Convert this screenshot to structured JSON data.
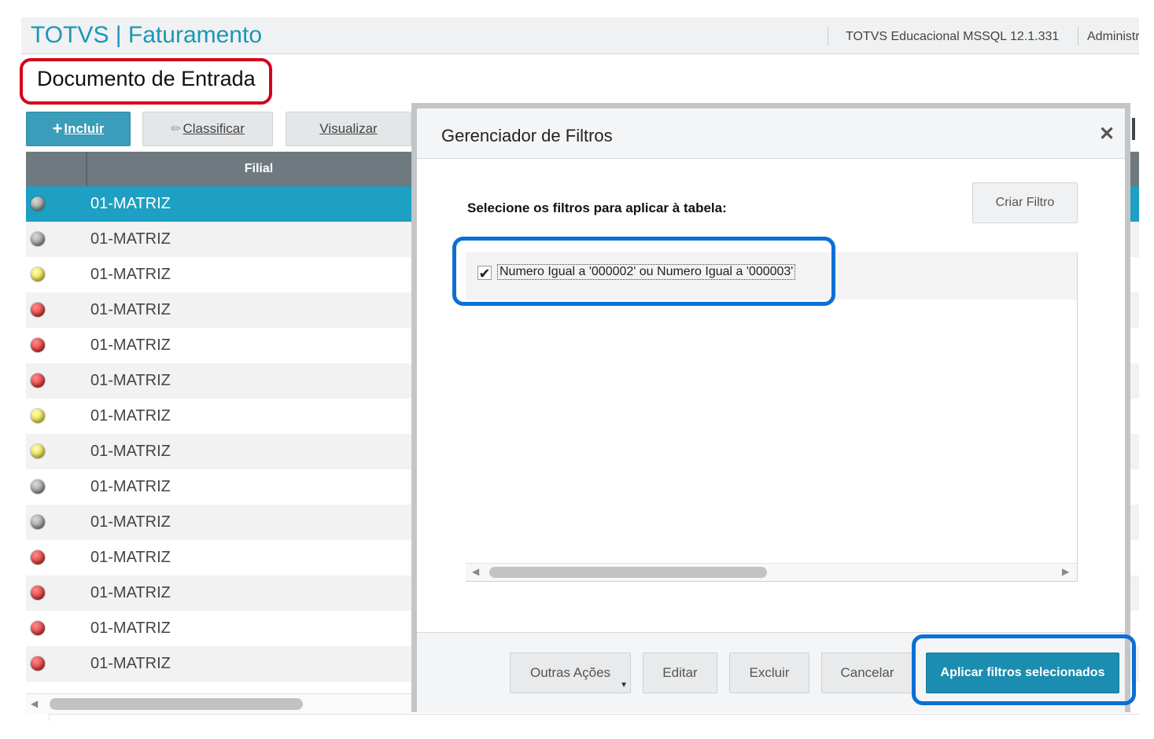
{
  "header": {
    "app_title": "TOTVS | Faturamento",
    "environment": "TOTVS Educacional MSSQL 12.1.331",
    "user": "Administr"
  },
  "page": {
    "title": "Documento de Entrada"
  },
  "toolbar": {
    "incluir_label": "Incluir",
    "classificar_label": "Classificar",
    "visualizar_label": "Visualizar"
  },
  "grid": {
    "columns": [
      "",
      "Filial"
    ],
    "rows": [
      {
        "status": "gray",
        "filial": "01-MATRIZ",
        "selected": true
      },
      {
        "status": "gray",
        "filial": "01-MATRIZ"
      },
      {
        "status": "yellow",
        "filial": "01-MATRIZ"
      },
      {
        "status": "red",
        "filial": "01-MATRIZ"
      },
      {
        "status": "red",
        "filial": "01-MATRIZ"
      },
      {
        "status": "red",
        "filial": "01-MATRIZ"
      },
      {
        "status": "yellow",
        "filial": "01-MATRIZ"
      },
      {
        "status": "yellow",
        "filial": "01-MATRIZ"
      },
      {
        "status": "gray",
        "filial": "01-MATRIZ"
      },
      {
        "status": "gray",
        "filial": "01-MATRIZ"
      },
      {
        "status": "red",
        "filial": "01-MATRIZ"
      },
      {
        "status": "red",
        "filial": "01-MATRIZ"
      },
      {
        "status": "red",
        "filial": "01-MATRIZ"
      },
      {
        "status": "red",
        "filial": "01-MATRIZ"
      }
    ]
  },
  "modal": {
    "title": "Gerenciador de Filtros",
    "close_icon": "close-icon",
    "instruction": "Selecione os filtros para aplicar à tabela:",
    "create_filter_label": "Criar Filtro",
    "filters": [
      {
        "label": "Numero Igual a '000002' ou Numero Igual a '000003'",
        "checked": true
      }
    ],
    "footer": {
      "outras_acoes_label": "Outras Ações",
      "editar_label": "Editar",
      "excluir_label": "Excluir",
      "cancelar_label": "Cancelar",
      "aplicar_label": "Aplicar filtros selecionados"
    }
  },
  "colors": {
    "brand": "#1b97b8",
    "primary_button": "#1a8db0",
    "selected_row": "#1e9fc4",
    "highlight_red": "#d3001a",
    "highlight_blue": "#0b6fd6"
  }
}
